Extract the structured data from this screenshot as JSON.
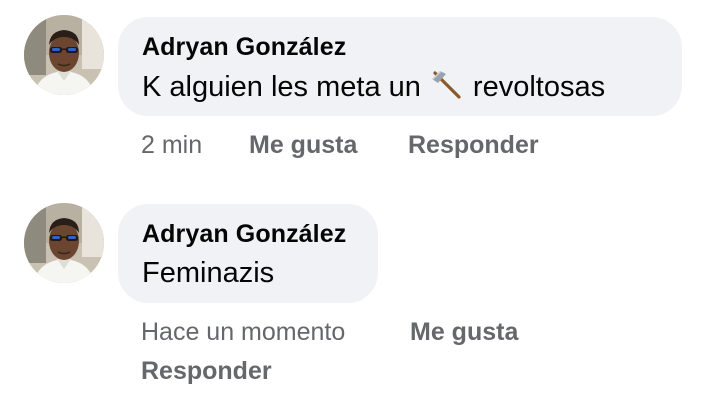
{
  "comments": [
    {
      "author": "Adryan González",
      "text_before": "K alguien les meta un",
      "emoji": "axe-emoji",
      "text_after": "revoltosas",
      "time": "2 min",
      "like_label": "Me gusta",
      "reply_label": "Responder"
    },
    {
      "author": "Adryan González",
      "text": "Feminazis",
      "time": "Hace un momento",
      "like_label": "Me gusta",
      "reply_label": "Responder"
    }
  ],
  "colors": {
    "bubble": "#f0f2f5",
    "meta_text": "#65676b",
    "body_text": "#050505"
  }
}
